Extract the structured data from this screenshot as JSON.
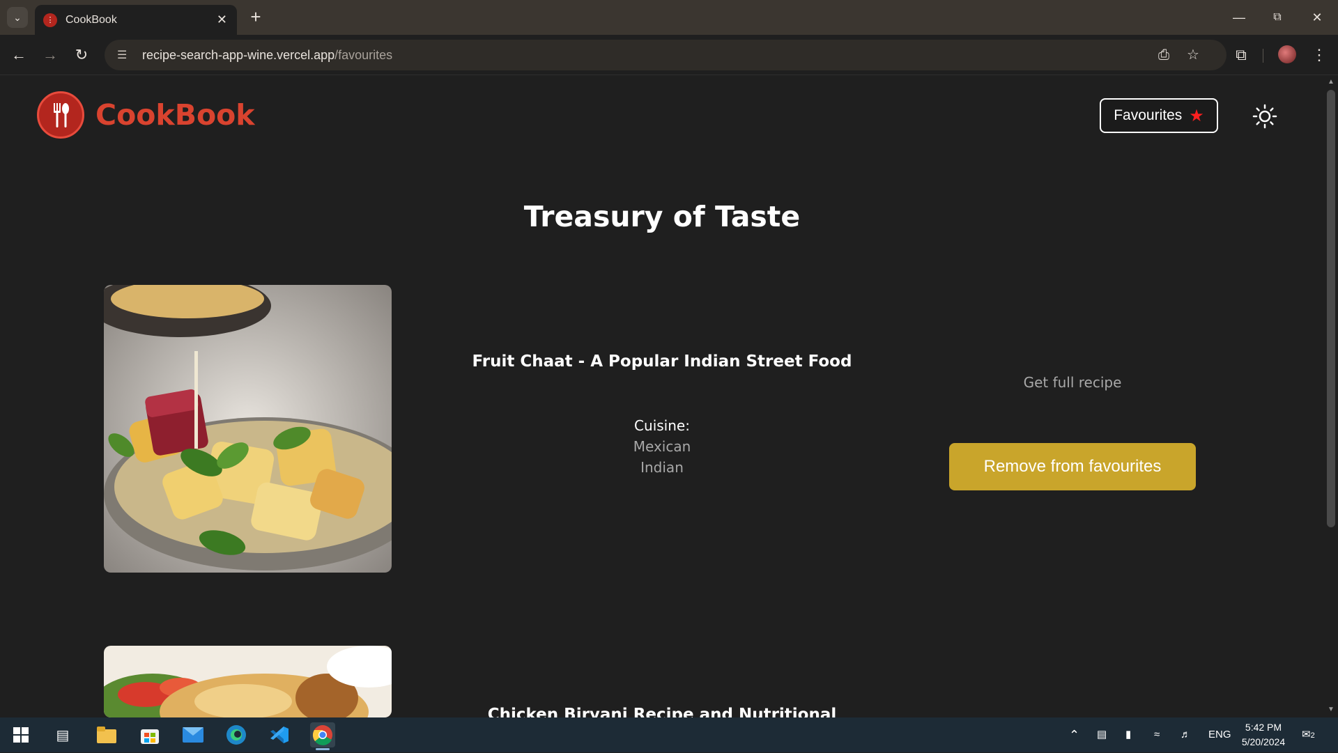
{
  "browser": {
    "tab_title": "CookBook",
    "url_host": "recipe-search-app-wine.vercel.app",
    "url_path": "/favourites"
  },
  "header": {
    "brand": "CookBook",
    "favourites_label": "Favourites"
  },
  "main": {
    "title": "Treasury of Taste",
    "recipes": [
      {
        "title": "Fruit Chaat - A Popular Indian Street Food",
        "cuisine_label": "Cuisine:",
        "cuisines": [
          "Mexican",
          "Indian"
        ],
        "get_recipe_label": "Get full recipe",
        "remove_label": "Remove from favourites"
      },
      {
        "title": "Chicken Biryani Recipe and Nutritional"
      }
    ]
  },
  "taskbar": {
    "language": "ENG",
    "time": "5:42 PM",
    "date": "5/20/2024",
    "notification_count": "2"
  },
  "colors": {
    "brand": "#d9432f",
    "accent_button": "#c9a52b",
    "star": "#ff1f1f",
    "background": "#1f1f1f"
  },
  "icons": [
    "tab-search-icon",
    "close-icon",
    "plus-icon",
    "minimize-icon",
    "restore-icon",
    "back-icon",
    "forward-icon",
    "reload-icon",
    "site-info-icon",
    "install-icon",
    "bookmark-star-icon",
    "extensions-icon",
    "menu-icon",
    "sun-icon",
    "star-icon",
    "windows-start-icon"
  ]
}
